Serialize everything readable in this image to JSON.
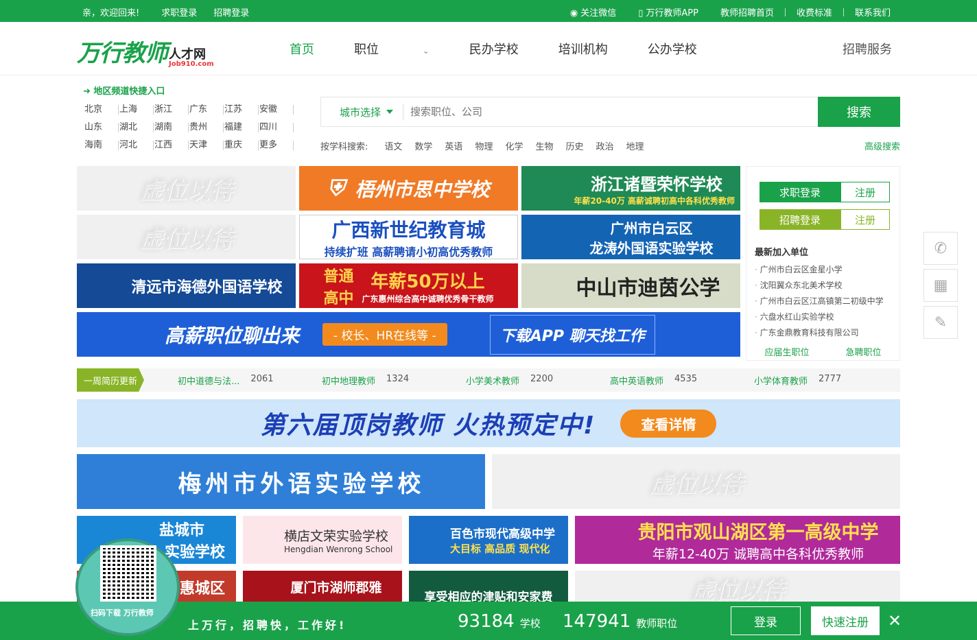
{
  "topbar": {
    "welcome": "亲，欢迎回来!",
    "job_login": "求职登录",
    "recruit_login": "招聘登录",
    "wechat": "关注微信",
    "app": "万行教师APP",
    "home": "教师招聘首页",
    "fees": "收费标准",
    "contact": "联系我们"
  },
  "logo": {
    "main": "万行教师",
    "sub": "人才网",
    "domain": "Job910.com"
  },
  "nav": {
    "items": [
      "首页",
      "职位",
      "民办学校",
      "培训机构",
      "公办学校"
    ],
    "service": "招聘服务"
  },
  "region": {
    "title": "地区频道快捷入口",
    "cities": [
      "北京",
      "上海",
      "浙江",
      "广东",
      "江苏",
      "安徽",
      "山东",
      "湖北",
      "湖南",
      "贵州",
      "福建",
      "四川",
      "海南",
      "河北",
      "江西",
      "天津",
      "重庆",
      "更多"
    ]
  },
  "search": {
    "city_label": "城市选择",
    "placeholder": "搜索职位、公司",
    "button": "搜索",
    "subject_label": "按学科搜索:",
    "subjects": [
      "语文",
      "数学",
      "英语",
      "物理",
      "化学",
      "生物",
      "历史",
      "政治",
      "地理"
    ],
    "advanced": "高级搜索"
  },
  "banners": {
    "vacant": "虚位以待",
    "wuzhou": "梧州市思中学校",
    "zhuji_title": "浙江诸暨荣怀学校",
    "zhuji_sub": "年薪20-40万 高薪诚聘初高中各科优秀教师",
    "guangxi_title": "广西新世纪教育城",
    "guangxi_sub": "持续扩班 高薪聘请小初高优秀教师",
    "baiyun_title": "广州市白云区",
    "baiyun_sub": "龙涛外国语实验学校",
    "qingyuan": "清远市海德外国语学校",
    "huizhou_left1": "普通",
    "huizhou_left2": "高中",
    "huizhou_title": "年薪50万以上",
    "huizhou_sub": "广东惠州综合高中诚聘优秀骨干教师",
    "zhongshan": "中山市迪茵公学",
    "app_left": "高薪职位聊出来",
    "app_mid": "- 校长、HR在线等 -",
    "app_right": "下载APP  聊天找工作",
    "top_teacher": "第六届顶岗教师  火热预定中!",
    "top_teacher_btn": "查看详情",
    "meizhou": "梅州市外语实验学校",
    "yancheng1": "盐城市",
    "yancheng2": "实验学校",
    "hengdian_title": "横店文荣实验学校",
    "hengdian_sub": "Hengdian Wenrong School",
    "baise_title": "百色市现代高级中学",
    "baise_sub": "大目标 高品质 现代化",
    "guiyang_title": "贵阳市观山湖区第一高级中学",
    "guiyang_sub": "年薪12-40万 诚聘高中各科优秀教师",
    "huicheng": "惠城区",
    "xiamen": "厦门市湖师郡雅",
    "allowance": "享受相应的津贴和安家费"
  },
  "sidebox": {
    "job_login": "求职登录",
    "register": "注册",
    "recruit_login": "招聘登录",
    "new_units_title": "最新加入单位",
    "new_units": [
      "广州市白云区金星小学",
      "沈阳翼众东北美术学校",
      "广州市白云区江高镇第二初级中学",
      "六盘水红山实验学校",
      "广东金鼎教育科技有限公司"
    ],
    "grad_jobs": "应届生职位",
    "urgent_jobs": "急聘职位"
  },
  "weekly": {
    "tag": "一周简历更新",
    "items": [
      {
        "name": "初中道德与法...",
        "count": "2061"
      },
      {
        "name": "初中地理教师",
        "count": "1324"
      },
      {
        "name": "小学美术教师",
        "count": "2200"
      },
      {
        "name": "高中英语教师",
        "count": "4535"
      },
      {
        "name": "小学体育教师",
        "count": "2777"
      }
    ]
  },
  "bottom": {
    "slogan": "上万行，招聘快，工作好!",
    "schools_count": "93184",
    "schools_label": "学校",
    "jobs_count": "147941",
    "jobs_label": "教师职位",
    "login": "登录",
    "register": "快速注册",
    "close": "✕",
    "qr_caption": "扫码下载  万行教师"
  },
  "colors": {
    "brand": "#1aa24a",
    "recruit": "#8ab427"
  }
}
